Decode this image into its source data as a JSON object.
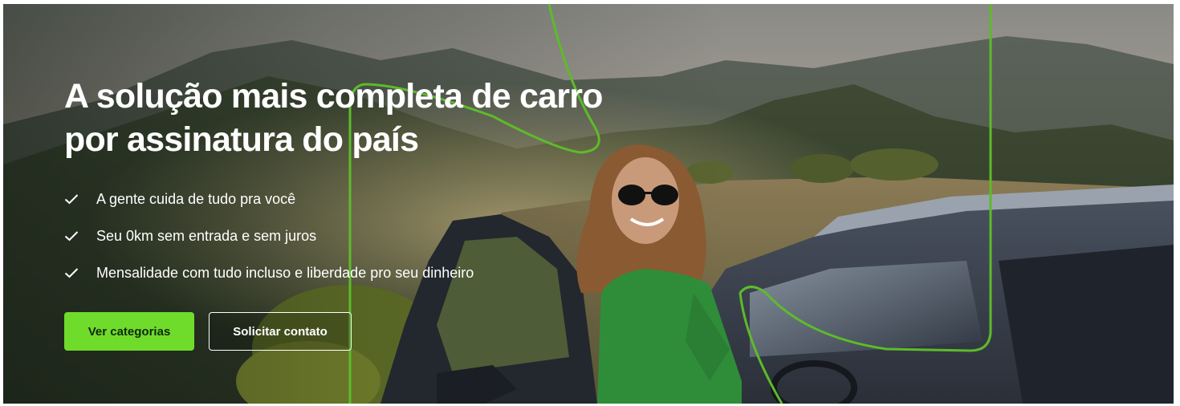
{
  "hero": {
    "headline_line1": "A solução mais completa de carro",
    "headline_line2": "por assinatura do país",
    "benefits": [
      {
        "icon": "check-icon",
        "text": "A gente cuida de tudo pra você"
      },
      {
        "icon": "check-icon",
        "text": "Seu 0km sem entrada e sem juros"
      },
      {
        "icon": "check-icon",
        "text": "Mensalidade com tudo incluso e liberdade pro seu dinheiro"
      }
    ],
    "primary_button": "Ver categorias",
    "secondary_button": "Solicitar contato"
  },
  "colors": {
    "accent_green": "#6fdc2c",
    "line_green": "#5dbb2a",
    "text": "#ffffff"
  }
}
